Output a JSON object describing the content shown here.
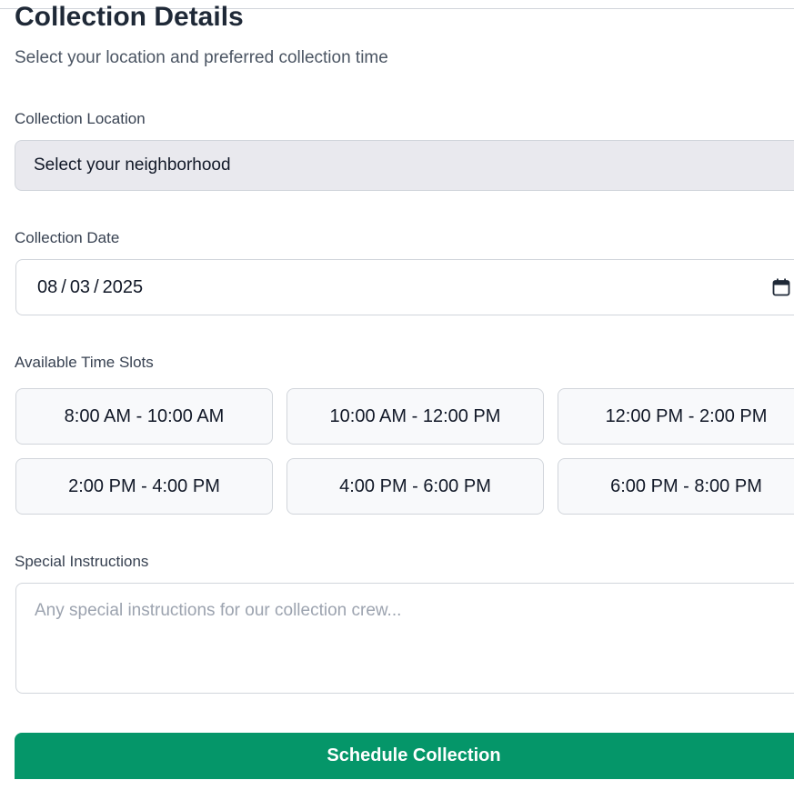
{
  "header": {
    "title": "Collection Details",
    "subtitle": "Select your location and preferred collection time"
  },
  "location": {
    "label": "Collection Location",
    "selected": "Select your neighborhood"
  },
  "date": {
    "label": "Collection Date",
    "month": "08",
    "day": "03",
    "year": "2025",
    "separator": "/",
    "icon": "calendar-icon"
  },
  "time_slots": {
    "label": "Available Time Slots",
    "slots": [
      "8:00 AM - 10:00 AM",
      "10:00 AM - 12:00 PM",
      "12:00 PM - 2:00 PM",
      "2:00 PM - 4:00 PM",
      "4:00 PM - 6:00 PM",
      "6:00 PM - 8:00 PM"
    ]
  },
  "instructions": {
    "label": "Special Instructions",
    "placeholder": "Any special instructions for our collection crew..."
  },
  "submit": {
    "label": "Schedule Collection"
  },
  "colors": {
    "primary": "#059669",
    "text": "#1f2937",
    "muted": "#4b5563",
    "border": "#d1d5db",
    "select_bg": "#e9e9ee",
    "slot_bg": "#f8f9fb"
  }
}
